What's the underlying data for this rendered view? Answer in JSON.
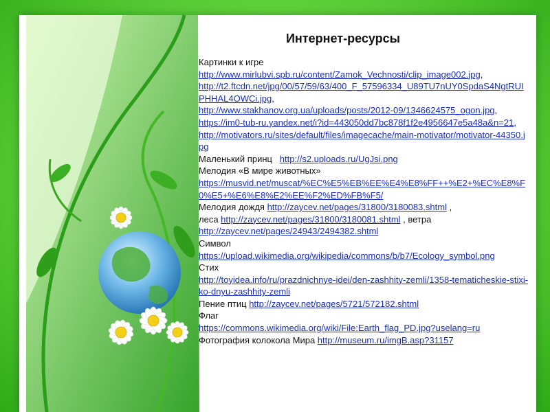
{
  "title": "Интернет-ресурсы",
  "sections": [
    {
      "label": "Картинки к игре",
      "links": [
        "http://www.mirlubvi.spb.ru/content/Zamok_Vechnosti/clip_image002.jpg",
        "http://t2.ftcdn.net/jpg/00/57/59/63/400_F_57596334_U89TU7nUY0SpdaS4NgtRUIPHHAL4OWCi.jpg",
        "http://www.stakhanov.org.ua/uploads/posts/2012-09/1346624575_ogon.jpg",
        "https://im0-tub-ru.yandex.net/i?id=443050dd7bc878f1f2e4956647e5a48a&n=21",
        "http://motivators.ru/sites/default/files/imagecache/main-motivator/motivator-44350.jpg"
      ]
    },
    {
      "label": "Маленький принц",
      "link": "http://s2.uploads.ru/UgJsi.png"
    },
    {
      "label": "Мелодия «В мире животных»",
      "link": "https://musvid.net/muscat/%EC%E5%EB%EE%E4%E8%FF++%E2+%EC%E8%F0%E5+%E6%E8%E2%EE%F2%ED%FB%F5/"
    },
    {
      "label_a": "Мелодия дождя",
      "link_a": "http://zaycev.net/pages/31800/3180083.shtml",
      "label_b": "леса",
      "link_b": "http://zaycev.net/pages/31800/3180081.shtml",
      "label_c": "ветра",
      "link_c": "http://zaycev.net/pages/24943/2494382.shtml"
    },
    {
      "label": "Символ",
      "link": "https://upload.wikimedia.org/wikipedia/commons/b/b7/Ecology_symbol.png"
    },
    {
      "label": "Стих",
      "link": "http://toyidea.info/ru/prazdnichnye-idei/den-zashhity-zemli/1358-tematicheskie-stixi-ko-dnyu-zashhity-zemli"
    },
    {
      "label": "Пение птиц",
      "link": "http://zaycev.net/pages/5721/572182.shtml"
    },
    {
      "label": "Флаг",
      "link": "https://commons.wikimedia.org/wiki/File:Earth_flag_PD.jpg?uselang=ru"
    },
    {
      "label": "Фотография колокола Мира",
      "link": "http://museum.ru/imgB.asp?31157"
    }
  ]
}
